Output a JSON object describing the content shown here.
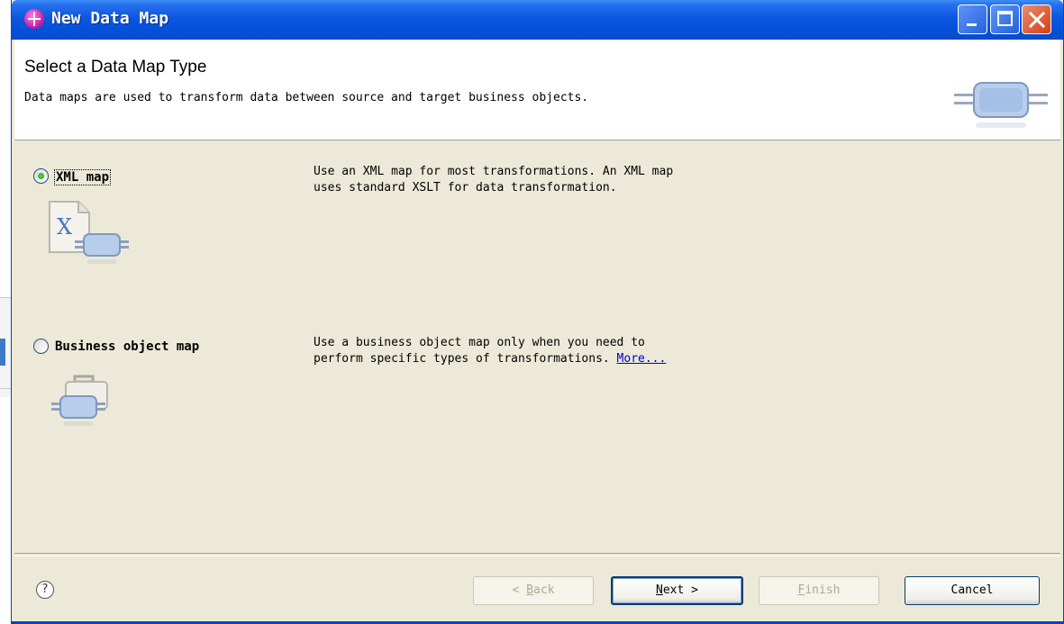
{
  "window": {
    "title": "New Data Map",
    "controls": {
      "minimize": "minimize",
      "maximize": "maximize",
      "close": "close"
    }
  },
  "header": {
    "title": "Select a Data Map Type",
    "description": "Data maps are used to transform data between source and target business objects.",
    "icon": "data-map-banner-icon"
  },
  "options": [
    {
      "label": "XML map",
      "selected": true,
      "icon": "xml-map-icon",
      "description_line1": "Use an XML map for most transformations. An XML map",
      "description_line2": "uses standard XSLT for data transformation."
    },
    {
      "label": "Business object map",
      "selected": false,
      "icon": "business-object-map-icon",
      "description_line1": "Use a business object map only when you need to",
      "description_line2": "perform specific types of transformations. ",
      "more_link": "More..."
    }
  ],
  "buttons": {
    "back": {
      "text": "< ",
      "mnemonic": "B",
      "rest": "ack",
      "enabled": false
    },
    "next": {
      "mnemonic": "N",
      "rest": "ext >",
      "enabled": true
    },
    "finish": {
      "mnemonic": "F",
      "rest": "inish",
      "enabled": false
    },
    "cancel": {
      "text": "Cancel",
      "enabled": true
    }
  },
  "help": {
    "glyph": "?"
  },
  "colors": {
    "titlebar": "#0a55dd",
    "dialog_bg": "#ece9d8",
    "link": "#0000cc",
    "radio_selected": "#2aa52a"
  }
}
